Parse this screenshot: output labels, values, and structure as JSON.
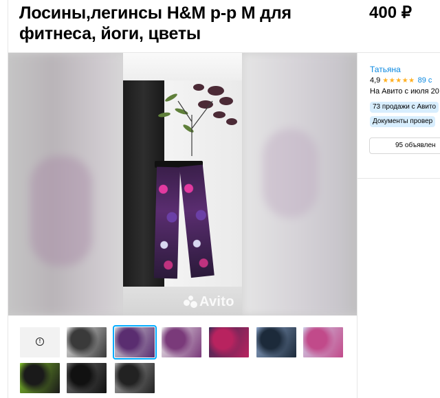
{
  "listing": {
    "title": "Лосины,легинсы H&M р-р M для фитнеса, йоги, цветы",
    "price": "400 ₽"
  },
  "gallery": {
    "watermark": "Avito",
    "thumbnails": [
      {
        "kind": "video",
        "icon": "warning-circle-icon",
        "icon_glyph": "!"
      },
      {
        "kind": "photo",
        "colors": [
          "#3a3a3a",
          "#e8e8e8"
        ]
      },
      {
        "kind": "photo",
        "selected": true,
        "colors": [
          "#5a2d70",
          "#d9d9d9"
        ]
      },
      {
        "kind": "photo",
        "colors": [
          "#7a3a7a",
          "#efefef"
        ]
      },
      {
        "kind": "photo",
        "colors": [
          "#b8235f",
          "#3b2a55"
        ]
      },
      {
        "kind": "photo",
        "colors": [
          "#1c2a3a",
          "#8aa3c7"
        ]
      },
      {
        "kind": "photo",
        "colors": [
          "#c14a8a",
          "#d0d0e8"
        ]
      },
      {
        "kind": "photo",
        "colors": [
          "#1a1a1a",
          "#7fbf2a"
        ]
      },
      {
        "kind": "photo",
        "colors": [
          "#111111",
          "#6a6a6a"
        ]
      },
      {
        "kind": "photo",
        "colors": [
          "#222222",
          "#a8a8a8"
        ]
      }
    ]
  },
  "seller": {
    "name": "Татьяна",
    "rating": "4,9",
    "stars": "★★★★★",
    "reviews": "89 с",
    "since": "На Авито с июля 20",
    "badges": [
      "73 продажи с Авито",
      "Документы провер"
    ],
    "all_ads_label": "95 объявлен"
  },
  "colors": {
    "accent": "#00aaff",
    "link": "#0a88e0",
    "star": "#ffb021",
    "badge_bg": "#d8eefe"
  }
}
